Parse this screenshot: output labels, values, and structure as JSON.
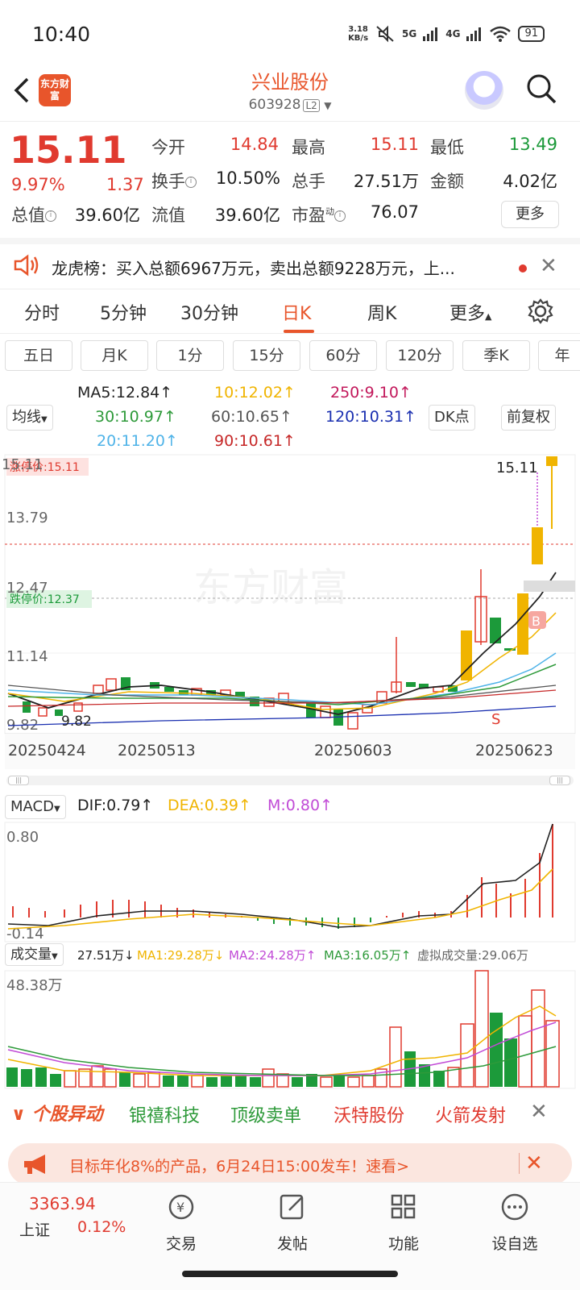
{
  "status_bar": {
    "time": "10:40",
    "net_speed_value": "3.18",
    "net_speed_unit": "KB/s",
    "net_5g": "5G",
    "net_4g": "4G",
    "battery": "91"
  },
  "header": {
    "logo_text": "东方财富",
    "title": "兴业股份",
    "code": "603928",
    "level": "L2"
  },
  "quote": {
    "price": "15.11",
    "change_pct": "9.97%",
    "change": "1.37",
    "open_label": "今开",
    "open": "14.84",
    "high_label": "最高",
    "high": "15.11",
    "low_label": "最低",
    "low": "13.49",
    "turnover_label": "换手",
    "turnover": "10.50%",
    "volume_label": "总手",
    "volume": "27.51万",
    "amount_label": "金额",
    "amount": "4.02亿",
    "mcap_label": "总值",
    "mcap": "39.60亿",
    "float_label": "流值",
    "float_cap": "39.60亿",
    "pe_label": "市盈",
    "pe_sup": "动",
    "pe": "76.07",
    "more_label": "更多"
  },
  "notice": {
    "text": "龙虎榜：买入总额6967万元，卖出总额9228万元，上..."
  },
  "tabs": [
    "分时",
    "5分钟",
    "30分钟",
    "日K",
    "周K",
    "更多"
  ],
  "active_tab": "日K",
  "periods": [
    "五日",
    "月K",
    "1分",
    "15分",
    "60分",
    "120分",
    "季K",
    "年"
  ],
  "ma": {
    "selector": "均线",
    "ma5": "MA5:12.84↑",
    "ma10": "10:12.02↑",
    "ma250": "250:9.10↑",
    "ma30": "30:10.97↑",
    "ma60": "60:10.65↑",
    "ma120": "120:10.31↑",
    "ma20": "20:11.20↑",
    "ma90": "90:10.61↑",
    "dk": "DK点",
    "adjust": "前复权",
    "colors": {
      "ma5": "#222222",
      "ma10": "#f0b400",
      "ma250": "#c2185b",
      "ma30": "#2e9a3a",
      "ma60": "#555555",
      "ma120": "#1a2fb0",
      "ma20": "#4fb3e8",
      "ma90": "#c62828"
    }
  },
  "kline": {
    "limit_up_label": "涨停价:15.11",
    "limit_down_label": "跌停价:12.37",
    "y_labels": [
      "15.11",
      "13.79",
      "12.47",
      "11.14",
      "9.82"
    ],
    "low_marker": "9.82",
    "high_marker": "15.11",
    "dates": [
      "20250424",
      "20250513",
      "20250603",
      "20250623"
    ],
    "watermark": "东方财富",
    "buy_marker": "B",
    "sell_marker": "S"
  },
  "macd": {
    "selector": "MACD",
    "dif": "DIF:0.79↑",
    "dea": "DEA:0.39↑",
    "m": "M:0.80↑",
    "top_label": "0.80",
    "bottom_label": "-0.14"
  },
  "volume": {
    "selector": "成交量",
    "current": "27.51万↓",
    "ma1": "MA1:29.28万↓",
    "ma2": "MA2:24.28万↑",
    "ma3": "MA3:16.05万↑",
    "virtual": "虚拟成交量:29.06万",
    "top_label": "48.38万"
  },
  "hot": {
    "label": "个股异动",
    "items": [
      "银禧科技",
      "顶级卖单",
      "沃特股份",
      "火箭发射"
    ]
  },
  "promo": {
    "text": "目标年化8%的产品，6月24日15:00发车！速看>"
  },
  "bottom_nav": {
    "index_value": "3363.94",
    "index_name": "上证",
    "index_pct": "0.12%",
    "items": [
      "交易",
      "发帖",
      "功能",
      "设自选"
    ]
  }
}
